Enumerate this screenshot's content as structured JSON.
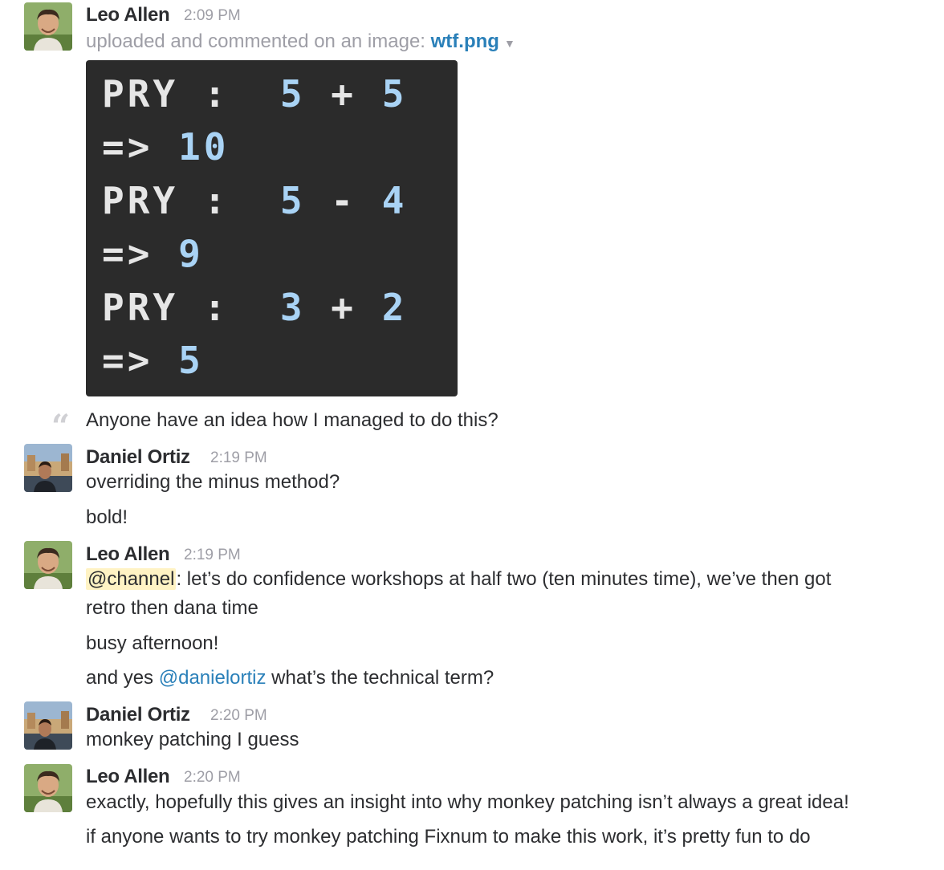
{
  "messages": [
    {
      "author": "Leo Allen",
      "time": "2:09 PM",
      "upload_prefix": "uploaded and commented on an image:",
      "file_name": "wtf.png",
      "image_code": [
        {
          "prompt": "PRY",
          "sep": ":",
          "a": "5",
          "op": "+",
          "b": "5"
        },
        {
          "arrow": "=>",
          "result": "10"
        },
        {
          "prompt": "PRY",
          "sep": ":",
          "a": "5",
          "op": "-",
          "b": "4"
        },
        {
          "arrow": "=>",
          "result": "9"
        },
        {
          "prompt": "PRY",
          "sep": ":",
          "a": "3",
          "op": "+",
          "b": "2"
        },
        {
          "arrow": "=>",
          "result": "5"
        }
      ],
      "comment": "Anyone have an idea how I managed to do this?"
    },
    {
      "author": "Daniel Ortiz",
      "time": "2:19 PM",
      "lines": [
        "overriding the minus method?",
        "bold!"
      ]
    },
    {
      "author": "Leo Allen",
      "time": "2:19 PM",
      "channel_mention": "@channel",
      "line1_rest": ": let’s do confidence workshops at half two (ten minutes time), we’ve then got",
      "line1_cont": "retro then dana time",
      "line2": "busy afternoon!",
      "line3_prefix": "and yes ",
      "line3_mention": "@danielortiz",
      "line3_suffix": " what’s the technical term?"
    },
    {
      "author": "Daniel Ortiz",
      "time": "2:20 PM",
      "lines": [
        "monkey patching I guess"
      ]
    },
    {
      "author": "Leo Allen",
      "time": "2:20 PM",
      "lines": [
        "exactly, hopefully this gives an insight into why monkey patching isn’t always a great idea!",
        "if anyone wants to try monkey patching Fixnum to make this work, it’s pretty fun to do"
      ]
    }
  ],
  "icons": {
    "quote": "“",
    "file_dropdown": "▼"
  },
  "colors": {
    "link": "#2a80b9",
    "timestamp": "#9e9ea6",
    "channel_highlight": "#fff3c4",
    "code_bg": "#2b2b2b",
    "code_number": "#a9d3f5"
  }
}
